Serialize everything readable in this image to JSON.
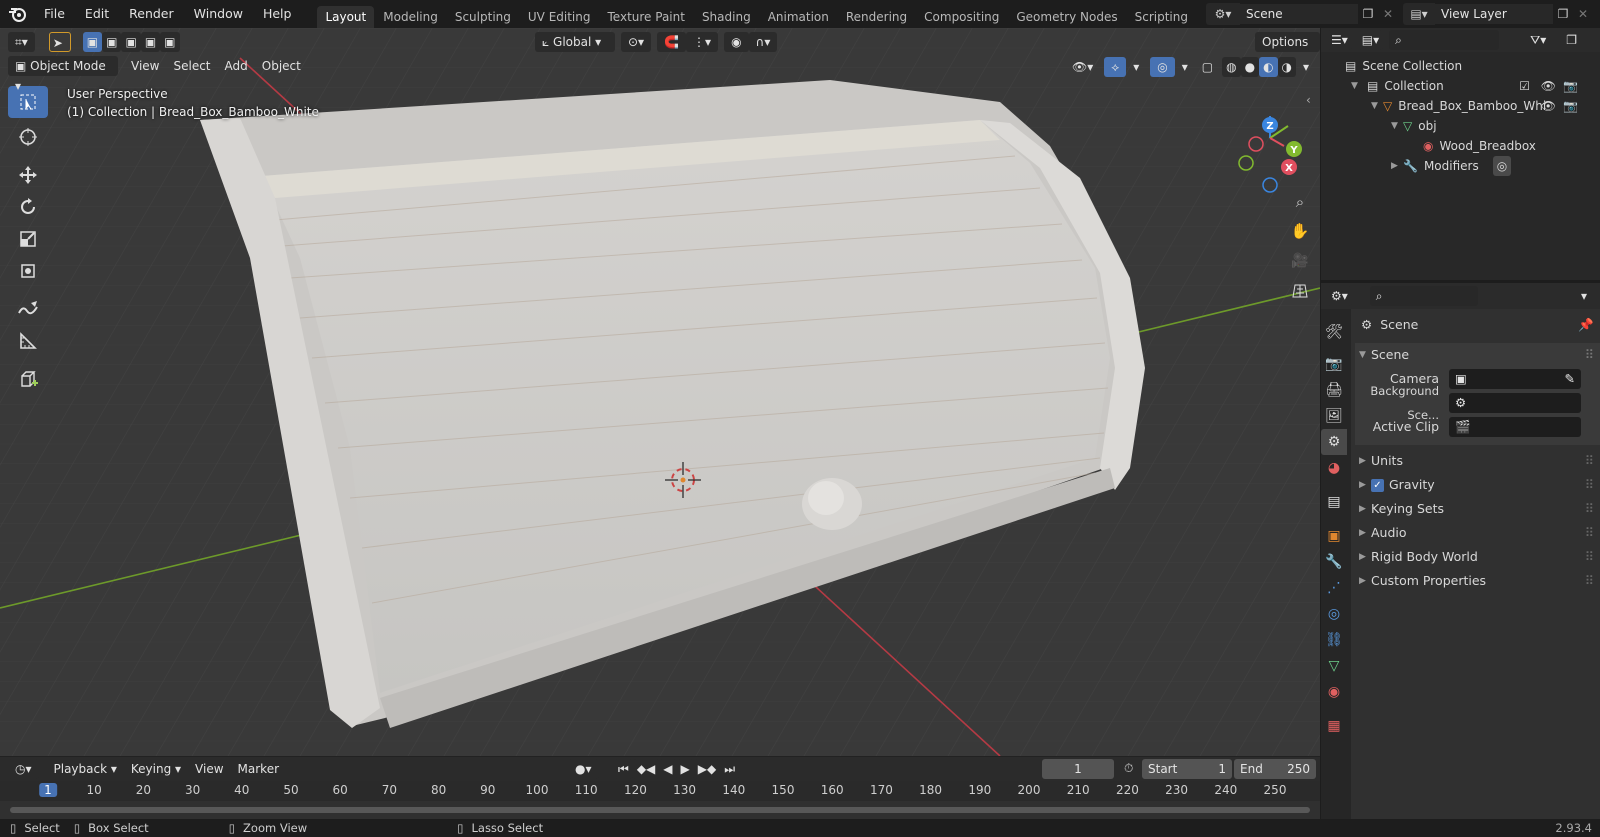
{
  "topbar": {
    "menus": [
      "File",
      "Edit",
      "Render",
      "Window",
      "Help"
    ],
    "workspaces": [
      "Layout",
      "Modeling",
      "Sculpting",
      "UV Editing",
      "Texture Paint",
      "Shading",
      "Animation",
      "Rendering",
      "Compositing",
      "Geometry Nodes",
      "Scripting"
    ],
    "active_workspace": "Layout",
    "scene_name": "Scene",
    "view_layer": "View Layer"
  },
  "viewport": {
    "transform_orientation": "Global",
    "options_label": "Options",
    "mode": "Object Mode",
    "menus": [
      "View",
      "Select",
      "Add",
      "Object"
    ],
    "perspective_label": "User Perspective",
    "collection_label": "(1) Collection | Bread_Box_Bamboo_White",
    "gizmo_axes": {
      "x": "X",
      "y": "Y",
      "z": "Z"
    }
  },
  "timeline": {
    "menus": [
      "Playback",
      "Keying",
      "View",
      "Marker"
    ],
    "current_frame": "1",
    "start_label": "Start",
    "start_value": "1",
    "end_label": "End",
    "end_value": "250",
    "ruler": [
      "1",
      "10",
      "20",
      "30",
      "40",
      "50",
      "60",
      "70",
      "80",
      "90",
      "100",
      "110",
      "120",
      "130",
      "140",
      "150",
      "160",
      "170",
      "180",
      "190",
      "200",
      "210",
      "220",
      "230",
      "240",
      "250"
    ]
  },
  "statusbar": {
    "select": "Select",
    "box_select": "Box Select",
    "zoom_view": "Zoom View",
    "lasso_select": "Lasso Select",
    "version": "2.93.4"
  },
  "outliner": {
    "scene_collection": "Scene Collection",
    "collection": "Collection",
    "object": "Bread_Box_Bamboo_Whi",
    "mesh": "obj",
    "material": "Wood_Breadbox",
    "modifiers": "Modifiers"
  },
  "properties": {
    "context_title": "Scene",
    "panel_title": "Scene",
    "camera_label": "Camera",
    "background_scene_label": "Background Sce...",
    "active_clip_label": "Active Clip",
    "sections": [
      "Units",
      "Gravity",
      "Keying Sets",
      "Audio",
      "Rigid Body World",
      "Custom Properties"
    ]
  },
  "colors": {
    "accent": "#4772b3",
    "x_axis": "#e04f5f",
    "y_axis": "#82ba2f",
    "z_axis": "#3a86e0",
    "object_orange": "#e0872f"
  }
}
